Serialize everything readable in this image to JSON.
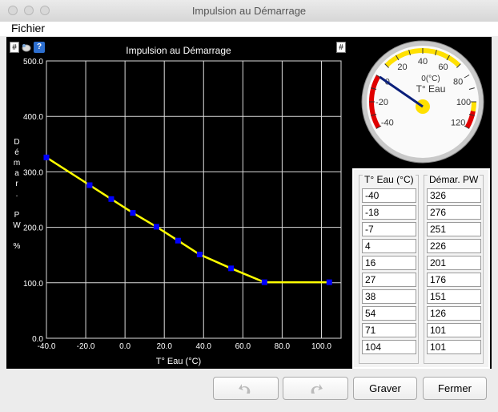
{
  "window": {
    "title": "Impulsion au Démarrage"
  },
  "menu": {
    "file": "Fichier"
  },
  "chart_data": {
    "type": "line",
    "title": "Impulsion au Démarrage",
    "xlabel": "T° Eau (°C)",
    "ylabel": "Démar. PW %",
    "xlim": [
      -40,
      110
    ],
    "ylim": [
      0,
      500
    ],
    "x_ticks": [
      "-40.0",
      "-20.0",
      "0.0",
      "20.0",
      "40.0",
      "60.0",
      "80.0",
      "100.0"
    ],
    "y_ticks": [
      "0.0",
      "100.0",
      "200.0",
      "300.0",
      "400.0",
      "500.0"
    ],
    "x": [
      -40,
      -18,
      -7,
      4,
      16,
      27,
      38,
      54,
      71,
      104
    ],
    "values": [
      326,
      276,
      251,
      226,
      201,
      176,
      151,
      126,
      101,
      101
    ],
    "grid": true,
    "line_color": "#ffff00",
    "point_color": "#0000ff"
  },
  "chart_buttons": {
    "hash_left": "#",
    "help": "?",
    "hash_right": "#"
  },
  "gauge": {
    "title": "T° Eau",
    "reading": "0(°C)",
    "value": 0,
    "min": -40,
    "max": 120,
    "tick_labels": [
      "-40",
      "-20",
      "0",
      "20",
      "40",
      "60",
      "80",
      "100",
      "120"
    ]
  },
  "table": {
    "col1_header": "T° Eau (°C)",
    "col2_header": "Démar. PW",
    "temps": [
      "-40",
      "-18",
      "-7",
      "4",
      "16",
      "27",
      "38",
      "54",
      "71",
      "104"
    ],
    "pw": [
      "326",
      "276",
      "251",
      "226",
      "201",
      "176",
      "151",
      "126",
      "101",
      "101"
    ]
  },
  "buttons": {
    "burn": "Graver",
    "close": "Fermer"
  },
  "icons": {
    "undo": "undo-icon",
    "redo": "redo-icon"
  }
}
